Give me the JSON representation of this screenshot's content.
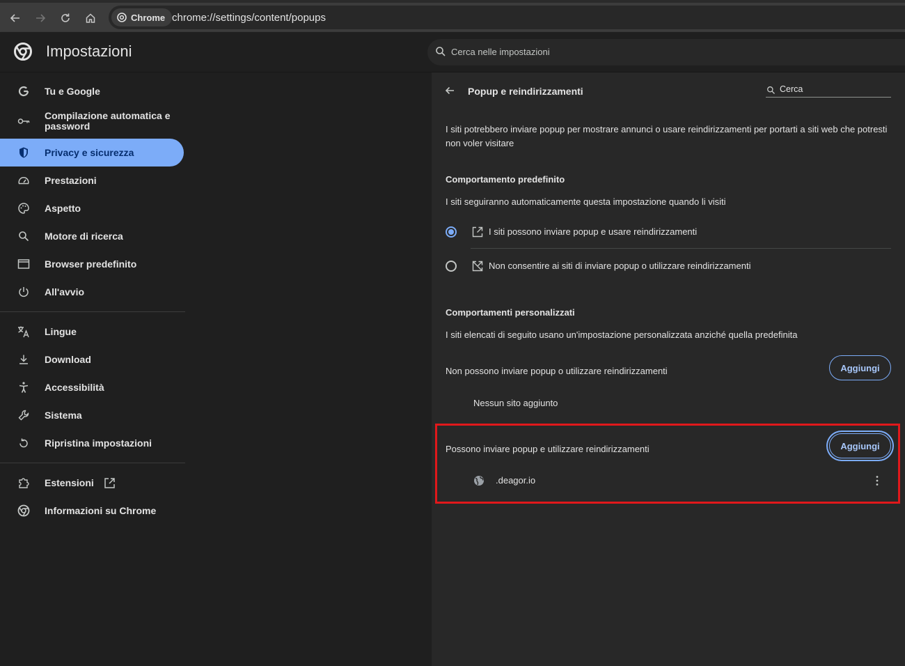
{
  "browser": {
    "chip_label": "Chrome",
    "url": "chrome://settings/content/popups"
  },
  "header": {
    "title": "Impostazioni",
    "search_placeholder": "Cerca nelle impostazioni"
  },
  "sidebar": {
    "items": [
      {
        "label": "Tu e Google",
        "icon": "google-g-icon"
      },
      {
        "label": "Compilazione automatica e password",
        "icon": "key-icon"
      },
      {
        "label": "Privacy e sicurezza",
        "icon": "shield-icon",
        "active": true
      },
      {
        "label": "Prestazioni",
        "icon": "speedometer-icon"
      },
      {
        "label": "Aspetto",
        "icon": "palette-icon"
      },
      {
        "label": "Motore di ricerca",
        "icon": "search-icon"
      },
      {
        "label": "Browser predefinito",
        "icon": "browser-window-icon"
      },
      {
        "label": "All'avvio",
        "icon": "power-icon"
      },
      {
        "label": "Lingue",
        "icon": "translate-icon"
      },
      {
        "label": "Download",
        "icon": "download-icon"
      },
      {
        "label": "Accessibilità",
        "icon": "accessibility-icon"
      },
      {
        "label": "Sistema",
        "icon": "wrench-icon"
      },
      {
        "label": "Ripristina impostazioni",
        "icon": "reset-icon"
      },
      {
        "label": "Estensioni",
        "icon": "puzzle-icon"
      },
      {
        "label": "Informazioni su Chrome",
        "icon": "chrome-icon"
      }
    ]
  },
  "page": {
    "title": "Popup e reindirizzamenti",
    "search_label": "Cerca",
    "description": "I siti potrebbero inviare popup per mostrare annunci o usare reindirizzamenti per portarti a siti web che potresti non voler visitare",
    "default_heading": "Comportamento predefinito",
    "default_sub": "I siti seguiranno automaticamente questa impostazione quando li visiti",
    "option_allow": "I siti possono inviare popup e usare reindirizzamenti",
    "option_block": "Non consentire ai siti di inviare popup o utilizzare reindirizzamenti",
    "custom_heading": "Comportamenti personalizzati",
    "custom_sub": "I siti elencati di seguito usano un'impostazione personalizzata anziché quella predefinita",
    "blocked_heading": "Non possono inviare popup o utilizzare reindirizzamenti",
    "add_label": "Aggiungi",
    "no_sites": "Nessun sito aggiunto",
    "allowed_heading": "Possono inviare popup e utilizzare reindirizzamenti",
    "allowed_site": ".deagor.io"
  },
  "colors": {
    "accent": "#7cacf8",
    "highlight": "#e0181b"
  }
}
